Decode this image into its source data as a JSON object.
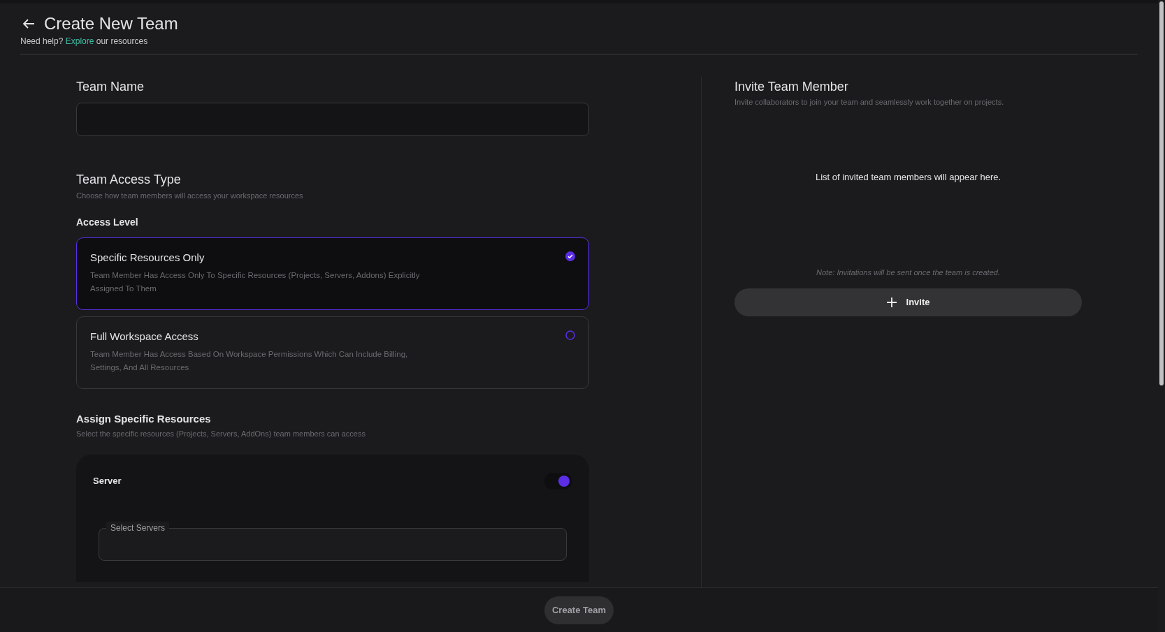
{
  "header": {
    "title": "Create New Team",
    "help": {
      "prefix": "Need help?",
      "link": "Explore",
      "suffix": "our resources"
    }
  },
  "team_name": {
    "label": "Team Name"
  },
  "access": {
    "title": "Team Access Type",
    "subtitle": "Choose how team members will access your workspace resources",
    "level_label": "Access Level",
    "options": [
      {
        "title": "Specific Resources Only",
        "description": "Team Member Has Access Only To Specific Resources (Projects, Servers, Addons) Explicitly Assigned To Them",
        "selected": true
      },
      {
        "title": "Full Workspace Access",
        "description": "Team Member Has Access Based On Workspace Permissions Which Can Include Billing, Settings, And All Resources",
        "selected": false
      }
    ]
  },
  "assign": {
    "title": "Assign Specific Resources",
    "subtitle": "Select the specific resources (Projects, Servers, AddOns) team members can access",
    "resources": [
      {
        "label": "Server",
        "on": true,
        "select_label": "Select Servers"
      }
    ]
  },
  "invite": {
    "title": "Invite Team Member",
    "subtitle": "Invite collaborators to join your team and seamlessly work together on projects.",
    "empty": "List of invited team members will appear here.",
    "note": "Note: Invitations will be sent once the team is created.",
    "button": "Invite"
  },
  "footer": {
    "button": "Create Team"
  }
}
